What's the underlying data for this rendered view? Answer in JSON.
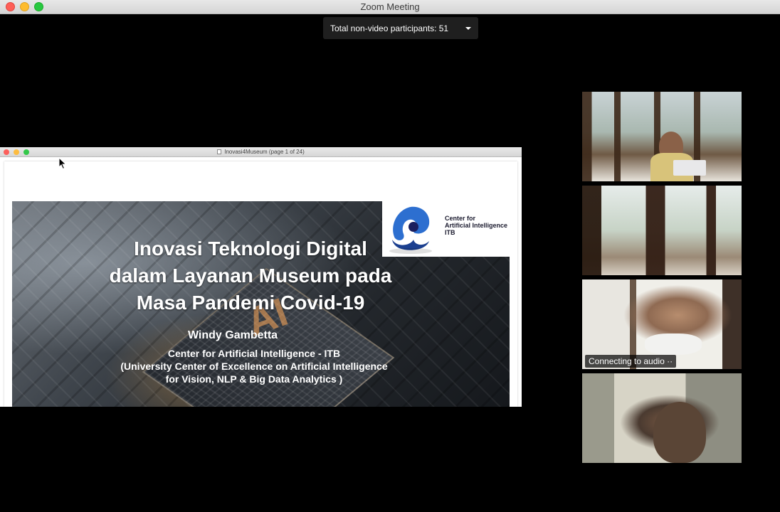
{
  "window": {
    "title": "Zoom Meeting"
  },
  "participants": {
    "label": "Total non-video participants: 51"
  },
  "shared_window": {
    "title": "Inovasi4Museum (page 1 of 24)"
  },
  "slide": {
    "title": "Inovasi Teknologi Digital dalam Layanan Museum pada Masa Pandemi Covid-19",
    "title_lines": [
      "Inovasi Teknologi Digital",
      "dalam Layanan Museum pada",
      "Masa Pandemi Covid-19"
    ],
    "author": "Windy Gambetta",
    "affiliation_lines": [
      "Center for Artificial Intelligence - ITB",
      "(University Center of Excellence on Artificial Intelligence",
      "for Vision, NLP & Big Data Analytics )"
    ],
    "logo_lines": [
      "Center for",
      "Artificial Intelligence",
      "ITB"
    ]
  },
  "videos": [
    {
      "label": ""
    },
    {
      "label": ""
    },
    {
      "label": "Connecting to audio ··"
    },
    {
      "label": ""
    }
  ],
  "colors": {
    "background": "#000000",
    "accent_blue": "#2d6fd0"
  }
}
